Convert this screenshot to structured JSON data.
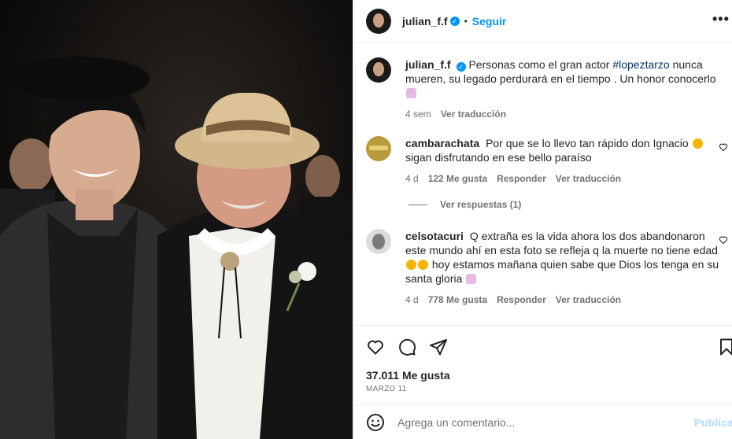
{
  "photo": {
    "alt_name": "post-photo"
  },
  "header": {
    "username": "julian_f.f",
    "follow_label": "Seguir",
    "separator": "•",
    "more_label": "•••"
  },
  "caption": {
    "username": "julian_f.f",
    "text_before": "Personas como el gran actor",
    "hashtag": "#lopeztarzo",
    "text_after": "nunca mueren, su legado perdurará en el tiempo . Un honor conocerlo",
    "time": "4 sem",
    "translate_label": "Ver traducción"
  },
  "comments": [
    {
      "username": "cambarachata",
      "text": "Por que se lo llevo tan rápido don Ignacio",
      "text_2": "sigan disfrutando en ese bello paraíso",
      "time": "4 d",
      "likes": "122 Me gusta",
      "reply_label": "Responder",
      "translate_label": "Ver traducción",
      "view_replies": "Ver respuestas (1)"
    },
    {
      "username": "celsotacuri",
      "text": "Q extraña es la vida ahora los dos abandonaron este mundo ahí en esta foto se refleja q la muerte no tiene edad",
      "text_2": "hoy estamos mañana quien sabe que Dios los tenga en su santa gloria",
      "time": "4 d",
      "likes": "778 Me gusta",
      "reply_label": "Responder",
      "translate_label": "Ver traducción"
    }
  ],
  "actions": {
    "like_icon": "heart-icon",
    "comment_icon": "comment-icon",
    "share_icon": "send-icon",
    "save_icon": "bookmark-icon"
  },
  "likes_count": "37.011 Me gusta",
  "post_date": "MARZO 11",
  "composer": {
    "placeholder": "Agrega un comentario...",
    "publish_label": "Publicar"
  },
  "colors": {
    "accent": "#0095f6",
    "publish_disabled": "#b3dbff",
    "secondary_text": "#737373",
    "divider": "#efefef"
  }
}
